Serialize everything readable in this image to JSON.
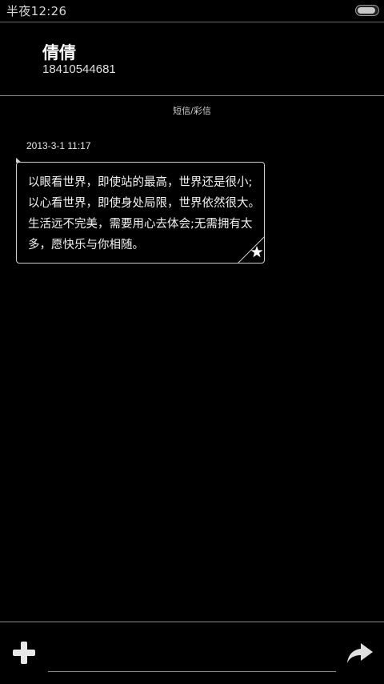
{
  "status_bar": {
    "time": "半夜12:26",
    "battery_level": 0.9
  },
  "contact": {
    "name": "倩倩",
    "number": "18410544681"
  },
  "conversation": {
    "type_label": "短信/彩信",
    "messages": [
      {
        "timestamp": "2013-3-1 11:17",
        "text": "以眼看世界，即使站的最高，世界还是很小;以心看世界，即使身处局限，世界依然很大。生活远不完美，需要用心去体会;无需拥有太多，愿快乐与你相随。",
        "starred": true
      }
    ]
  },
  "composer": {
    "input_value": "",
    "placeholder": "",
    "add_icon": "plus-icon",
    "send_icon": "forward-arrow-icon"
  },
  "colors": {
    "background": "#000000",
    "text": "#ffffff",
    "divider": "#8a8a8a",
    "bubble_border": "#cfcfcf"
  }
}
